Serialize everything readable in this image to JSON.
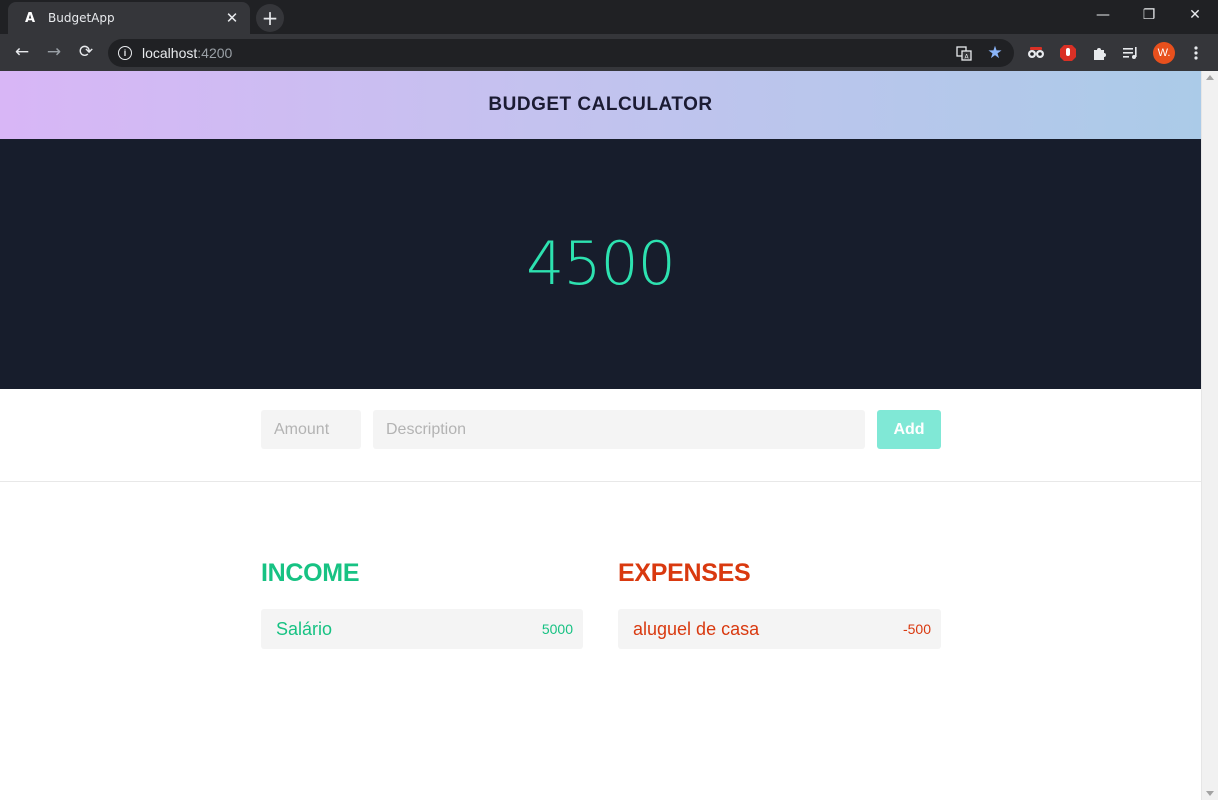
{
  "browser": {
    "tab_title": "BudgetApp",
    "tab_favicon": "A",
    "tab_close": "✕",
    "new_tab": "+",
    "url_host": "localhost",
    "url_port": ":4200",
    "avatar_letter": "W.",
    "window_controls": {
      "minimize": "—",
      "restore": "❐",
      "close": "✕"
    },
    "nav": {
      "back": "←",
      "forward": "→",
      "reload": "⟳"
    },
    "icons": [
      "translate-icon",
      "bookmark-star-icon",
      "extension-icon",
      "extension-block-icon",
      "puzzle-icon",
      "media-queue-icon",
      "more-menu-icon"
    ]
  },
  "app": {
    "title": "BUDGET CALCULATOR",
    "total": "4500",
    "form": {
      "amount_placeholder": "Amount",
      "description_placeholder": "Description",
      "add_label": "Add"
    },
    "income": {
      "heading": "INCOME",
      "items": [
        {
          "description": "Salário",
          "amount": "5000"
        }
      ]
    },
    "expenses": {
      "heading": "EXPENSES",
      "items": [
        {
          "description": "aluguel de casa",
          "amount": "-500"
        }
      ]
    }
  },
  "colors": {
    "income": "#17c283",
    "expense": "#d9390f",
    "total": "#2de2b0",
    "hero_bg": "#171d2c",
    "add_button": "#80e8d6"
  }
}
